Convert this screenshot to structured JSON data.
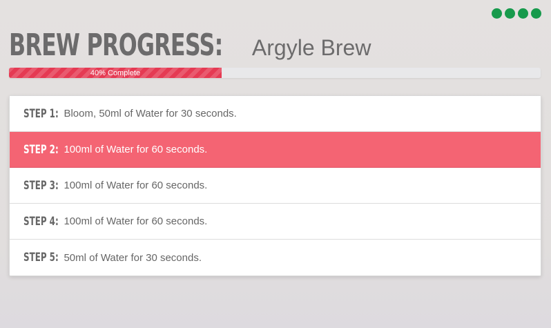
{
  "window_controls": {
    "count": 4,
    "color": "#179a4c"
  },
  "header": {
    "title": "BREW PROGRESS:",
    "brew_name": "Argyle Brew"
  },
  "progress": {
    "label": "40% Complete",
    "percent": 40,
    "color": "#e53a53"
  },
  "steps": [
    {
      "label": "STEP 1:",
      "text": "Bloom, 50ml of Water for 30 seconds.",
      "active": false
    },
    {
      "label": "STEP 2:",
      "text": "100ml of Water for 60 seconds.",
      "active": true
    },
    {
      "label": "STEP 3:",
      "text": "100ml of Water for 60 seconds.",
      "active": false
    },
    {
      "label": "STEP 4:",
      "text": "100ml of Water for 60 seconds.",
      "active": false
    },
    {
      "label": "STEP 5:",
      "text": "50ml of Water for 30 seconds.",
      "active": false
    }
  ],
  "colors": {
    "active_step": "#f46473",
    "text": "#666666"
  }
}
